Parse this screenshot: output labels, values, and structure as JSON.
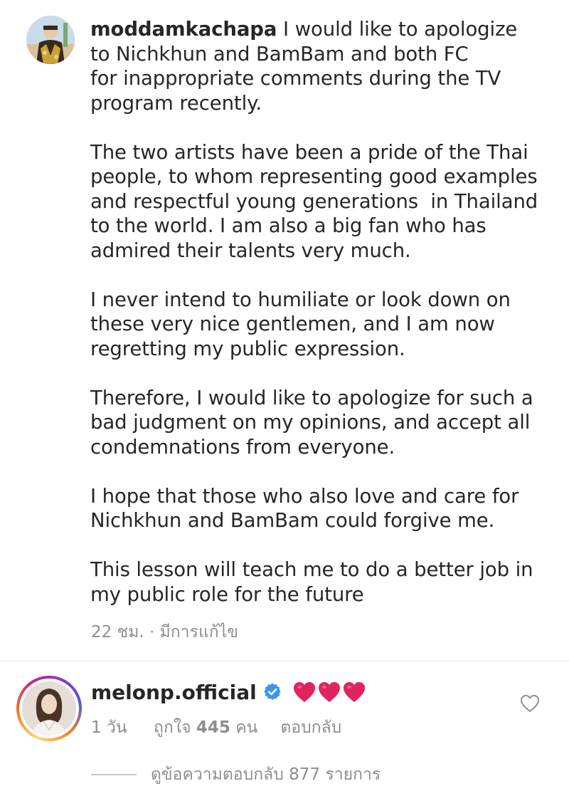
{
  "caption": {
    "username": "moddamkachapa",
    "text": " I would like to apologize\nto Nichkhun and BamBam and both FC\nfor inappropriate comments during the TV\nprogram recently.\n\nThe two artists have been a pride of the Thai\npeople, to whom representing good examples\nand respectful young generations  in Thailand\nto the world. I am also a big fan who has\nadmired their talents very much.\n\nI never intend to humiliate or look down on\nthese very nice gentlemen, and I am now\nregretting my public expression.\n\nTherefore, I would like to apologize for such a\nbad judgment on my opinions, and accept all\ncondemnations from everyone.\n\nI hope that those who also love and care for\nNichkhun and BamBam could forgive me.\n\nThis lesson will teach me to do a better job in\nmy public role for the future",
    "meta": "22 ชม. · มีการแก้ไข"
  },
  "comment": {
    "username": "melonp.official",
    "verified": true,
    "verified_icon": "verified-badge-icon",
    "emoji": "heart-emoji ×3",
    "time": "1 วัน",
    "likes_prefix": "ถูกใจ ",
    "likes_count": "445",
    "likes_suffix": " คน",
    "reply_label": "ตอบกลับ",
    "like_icon": "heart-outline-icon",
    "view_replies": "ดูข้อความตอบกลับ 877 รายการ"
  },
  "colors": {
    "text": "#262626",
    "secondary": "#8e8e8e",
    "verified": "#3897f0",
    "heart_emoji": "#e0245e"
  }
}
